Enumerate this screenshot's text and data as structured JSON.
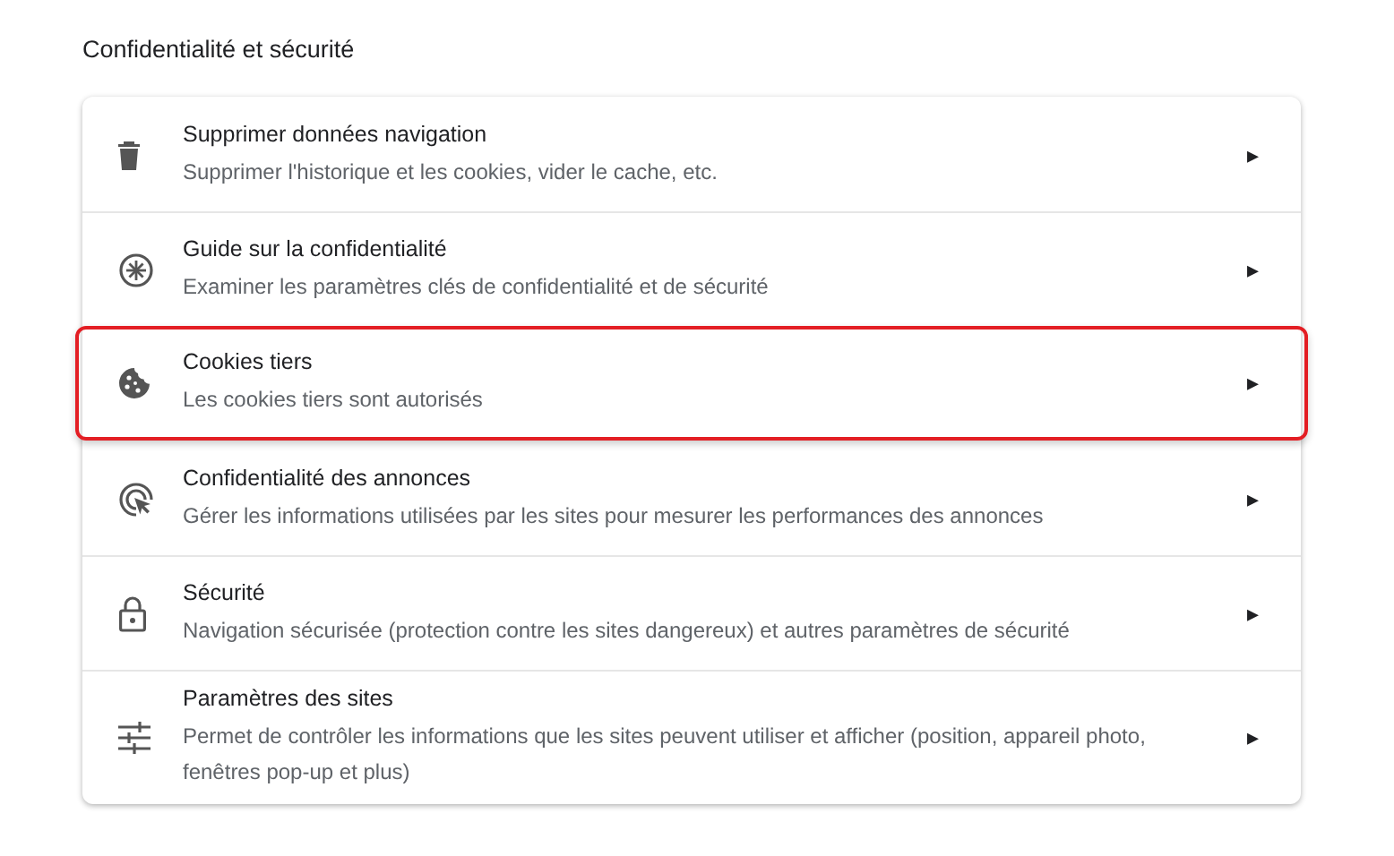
{
  "section_title": "Confidentialité et sécurité",
  "items": [
    {
      "kind": "trash",
      "title": "Supprimer données navigation",
      "description": "Supprimer l'historique et les cookies, vider le cache, etc.",
      "highlighted": false,
      "arrow": "▸"
    },
    {
      "kind": "guide",
      "title": "Guide sur la confidentialité",
      "description": "Examiner les paramètres clés de confidentialité et de sécurité",
      "highlighted": false,
      "arrow": "▸"
    },
    {
      "kind": "cookie",
      "title": "Cookies tiers",
      "description": "Les cookies tiers sont autorisés",
      "highlighted": true,
      "arrow": "▸"
    },
    {
      "kind": "ads",
      "title": "Confidentialité des annonces",
      "description": "Gérer les informations utilisées par les sites pour mesurer les performances des annonces",
      "highlighted": false,
      "arrow": "▸"
    },
    {
      "kind": "lock",
      "title": "Sécurité",
      "description": "Navigation sécurisée (protection contre les sites dangereux) et autres paramètres de sécurité",
      "highlighted": false,
      "arrow": "▸"
    },
    {
      "kind": "tune",
      "title": "Paramètres des sites",
      "description": "Permet de contrôler les informations que les sites peuvent utiliser et afficher (position, appareil photo, fenêtres pop-up et plus)",
      "highlighted": false,
      "arrow": "▸"
    }
  ]
}
